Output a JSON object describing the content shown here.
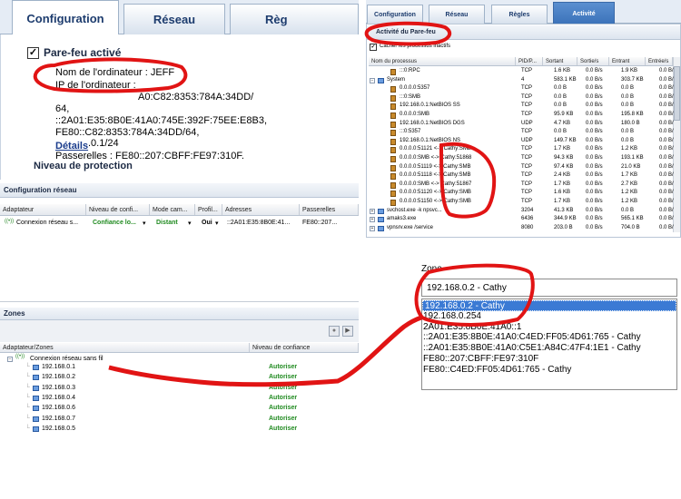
{
  "config": {
    "tabs": [
      "Configuration",
      "Réseau",
      "Règ"
    ],
    "firewall_label": "Pare-feu activé",
    "computer_name_label": "Nom de l'ordinateur : JEFF",
    "computer_ip_label": "IP de l'ordinateur :",
    "ip_lines": [
      "A0:C82:8353:784A:34DD/",
      "64,",
      "::2A01:E35:8B0E:41A0:745E:392F:75EE:E8B3,",
      "FE80::C82:8353:784A:34DD/64,",
      ".0.1/24"
    ],
    "details_link": "Détails",
    "gateways_line": "Passerelles : FE80::207:CBFF:FE97:310F.",
    "protection_level": "Niveau de protection"
  },
  "network_config": {
    "title": "Configuration réseau",
    "columns": [
      "Adaptateur",
      "Niveau de confi...",
      "Mode cam...",
      "Profil...",
      "Adresses",
      "Passerelles"
    ],
    "row": {
      "adapter": "Connexion réseau s...",
      "trust": "Confiance lo...",
      "mode": "Distant",
      "profile": "Oui",
      "addresses": "::2A01:E35:8B0E:41...",
      "gateways": "FE80::207..."
    }
  },
  "zones": {
    "title": "Zones",
    "columns": [
      "Adaptateur/Zones",
      "Niveau de confiance"
    ],
    "group": "Connexion réseau sans fil",
    "rows": [
      {
        "ip": "192.168.0.1",
        "trust": "Autoriser"
      },
      {
        "ip": "192.168.0.2",
        "trust": "Autoriser"
      },
      {
        "ip": "192.168.0.3",
        "trust": "Autoriser"
      },
      {
        "ip": "192.168.0.4",
        "trust": "Autoriser"
      },
      {
        "ip": "192.168.0.6",
        "trust": "Autoriser"
      },
      {
        "ip": "192.168.0.7",
        "trust": "Autoriser"
      },
      {
        "ip": "192.168.0.5",
        "trust": "Autoriser"
      }
    ]
  },
  "activity": {
    "tabs": [
      "Configuration",
      "Réseau",
      "Règles",
      "Activité"
    ],
    "section_title": "Activité du Pare-feu",
    "checkbox_label": "Cacher les processus inactifs",
    "columns": [
      "Nom du processus",
      "PID/P...",
      "Sortant",
      "Sortie/s",
      "Entrant",
      "Entrée/s"
    ],
    "rows": [
      {
        "name": ":::0:RPC",
        "pid": "TCP",
        "out": "1.6 KB",
        "outs": "0.0 B/s",
        "in": "1.9 KB",
        "ins": "0.0 B/"
      },
      {
        "name": "System",
        "pid": "4",
        "out": "583.1 KB",
        "outs": "0.0 B/s",
        "in": "303.7 KB",
        "ins": "0.0 B/"
      },
      {
        "name": "0.0.0.0:5357",
        "pid": "TCP",
        "out": "0.0 B",
        "outs": "0.0 B/s",
        "in": "0.0 B",
        "ins": "0.0 B/"
      },
      {
        "name": ":::0:SMB",
        "pid": "TCP",
        "out": "0.0 B",
        "outs": "0.0 B/s",
        "in": "0.0 B",
        "ins": "0.0 B/"
      },
      {
        "name": "192.168.0.1:NetBIOS SS",
        "pid": "TCP",
        "out": "0.0 B",
        "outs": "0.0 B/s",
        "in": "0.0 B",
        "ins": "0.0 B/"
      },
      {
        "name": "0.0.0.0:SMB",
        "pid": "TCP",
        "out": "95.9 KB",
        "outs": "0.0 B/s",
        "in": "195.8 KB",
        "ins": "0.0 B/"
      },
      {
        "name": "192.168.0.1:NetBIOS DGS",
        "pid": "UDP",
        "out": "4.7 KB",
        "outs": "0.0 B/s",
        "in": "180.0 B",
        "ins": "0.0 B/"
      },
      {
        "name": ":::0:5357",
        "pid": "TCP",
        "out": "0.0 B",
        "outs": "0.0 B/s",
        "in": "0.0 B",
        "ins": "0.0 B/"
      },
      {
        "name": "192.168.0.1:NetBIOS NS",
        "pid": "UDP",
        "out": "149.7 KB",
        "outs": "0.0 B/s",
        "in": "0.0 B",
        "ins": "0.0 B/"
      },
      {
        "name": "0.0.0.0:51121 <-> Cathy:SMB",
        "pid": "TCP",
        "out": "1.7 KB",
        "outs": "0.0 B/s",
        "in": "1.2 KB",
        "ins": "0.0 B/"
      },
      {
        "name": "0.0.0.0:SMB <-> Cathy:51868",
        "pid": "TCP",
        "out": "94.3 KB",
        "outs": "0.0 B/s",
        "in": "193.1 KB",
        "ins": "0.0 B/"
      },
      {
        "name": "0.0.0.0:51119 <-> Cathy:SMB",
        "pid": "TCP",
        "out": "97.4 KB",
        "outs": "0.0 B/s",
        "in": "21.0 KB",
        "ins": "0.0 B/"
      },
      {
        "name": "0.0.0.0:51118 <-> Cathy:SMB",
        "pid": "TCP",
        "out": "2.4 KB",
        "outs": "0.0 B/s",
        "in": "1.7 KB",
        "ins": "0.0 B/"
      },
      {
        "name": "0.0.0.0:SMB <-> Cathy:51867",
        "pid": "TCP",
        "out": "1.7 KB",
        "outs": "0.0 B/s",
        "in": "2.7 KB",
        "ins": "0.0 B/"
      },
      {
        "name": "0.0.0.0:51120 <-> Cathy:SMB",
        "pid": "TCP",
        "out": "1.6 KB",
        "outs": "0.0 B/s",
        "in": "1.2 KB",
        "ins": "0.0 B/"
      },
      {
        "name": "0.0.0.0:51150 <-> Cathy:SMB",
        "pid": "TCP",
        "out": "1.7 KB",
        "outs": "0.0 B/s",
        "in": "1.2 KB",
        "ins": "0.0 B/"
      },
      {
        "name": "svchost.exe -k npsvc...",
        "pid": "3204",
        "out": "41.3 KB",
        "outs": "0.0 B/s",
        "in": "0.0 B",
        "ins": "0.0 B/"
      },
      {
        "name": "amaks3.exe",
        "pid": "6436",
        "out": "344.9 KB",
        "outs": "0.0 B/s",
        "in": "565.1 KB",
        "ins": "0.0 B/"
      },
      {
        "name": "vpnsrv.exe /service",
        "pid": "8080",
        "out": "203.0 B",
        "outs": "0.0 B/s",
        "in": "704.0 B",
        "ins": "0.0 B/"
      }
    ]
  },
  "zone_dropdown": {
    "label": "Zone",
    "selected": "192.168.0.2 - Cathy",
    "options": [
      "192.168.0.2 - Cathy",
      "192.168.0.254",
      "2A01:E35:8B0E:41A0::1",
      "::2A01:E35:8B0E:41A0:C4ED:FF05:4D61:765 - Cathy",
      "::2A01:E35:8B0E:41A0:C5E1:A84C:47F4:1E1 - Cathy",
      "FE80::207:CBFF:FE97:310F",
      "FE80::C4ED:FF05:4D61:765 - Cathy"
    ],
    "highlighted_index": 0
  },
  "colors": {
    "annotation": "#e11414",
    "trust_green": "#1f8a1f",
    "selection": "#3b7ad4"
  }
}
